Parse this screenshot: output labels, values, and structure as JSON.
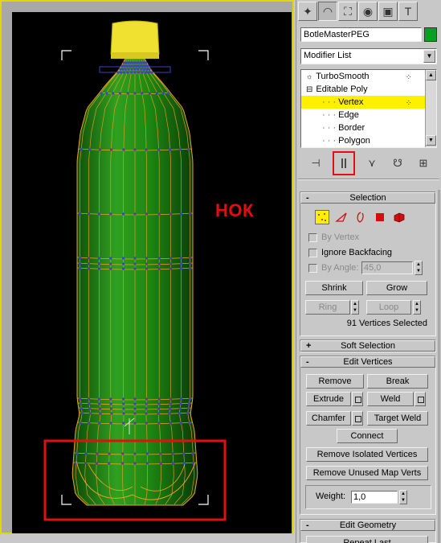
{
  "overlay_text": "НОК",
  "object_name": "BotleMasterPEG",
  "object_color": "#08a020",
  "modifier_list": "Modifier List",
  "tabs": [
    {
      "name": "create-tab-icon",
      "glyph": "✦"
    },
    {
      "name": "modify-tab-icon",
      "glyph": "◠"
    },
    {
      "name": "hierarchy-tab-icon",
      "glyph": "⛶"
    },
    {
      "name": "motion-tab-icon",
      "glyph": "◉"
    },
    {
      "name": "display-tab-icon",
      "glyph": "▣"
    },
    {
      "name": "utilities-tab-icon",
      "glyph": "T"
    }
  ],
  "stack": [
    {
      "label": "TurboSmooth",
      "bulb": "💡",
      "indent": 0,
      "selected": false
    },
    {
      "label": "Editable Poly",
      "prefix": "⊟",
      "indent": 0,
      "selected": false
    },
    {
      "label": "Vertex",
      "indent": 1,
      "selected": true
    },
    {
      "label": "Edge",
      "indent": 1,
      "selected": false
    },
    {
      "label": "Border",
      "indent": 1,
      "selected": false
    },
    {
      "label": "Polygon",
      "indent": 1,
      "selected": false
    }
  ],
  "selection": {
    "title": "Selection",
    "by_vertex": "By Vertex",
    "ignore_backfacing": "Ignore Backfacing",
    "by_angle": "By Angle:",
    "angle_value": "45,0",
    "shrink": "Shrink",
    "grow": "Grow",
    "ring": "Ring",
    "loop": "Loop",
    "status": "91 Vertices Selected"
  },
  "soft_selection": {
    "title": "Soft Selection",
    "sign": "+"
  },
  "edit_vertices": {
    "title": "Edit Vertices",
    "remove": "Remove",
    "break": "Break",
    "extrude": "Extrude",
    "weld": "Weld",
    "chamfer": "Chamfer",
    "target_weld": "Target Weld",
    "connect": "Connect",
    "remove_isolated": "Remove Isolated Vertices",
    "remove_unused": "Remove Unused Map Verts",
    "weight_label": "Weight:",
    "weight_value": "1,0"
  },
  "edit_geometry": {
    "title": "Edit Geometry",
    "repeat_last": "Repeat Last"
  },
  "colors": {
    "highlight": "#fff000",
    "annotation": "#e01010",
    "bottle": "#1a8a10",
    "cap": "#f0e030",
    "wire": "#f0a020",
    "vertex": "#4040c0"
  }
}
